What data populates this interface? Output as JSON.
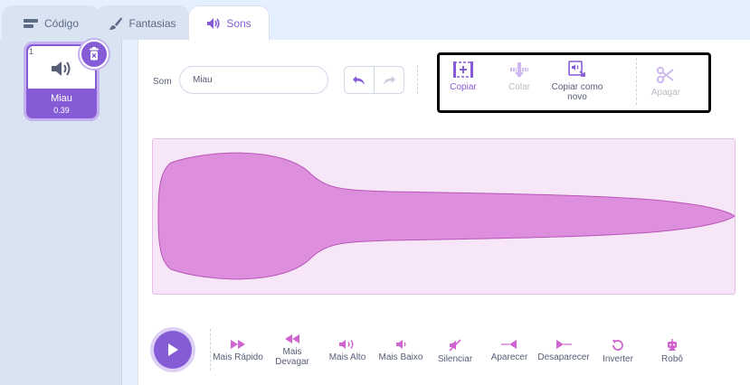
{
  "tabs": [
    {
      "label": "Código",
      "icon": "code-icon"
    },
    {
      "label": "Fantasias",
      "icon": "brush-icon"
    },
    {
      "label": "Sons",
      "icon": "speaker-icon"
    }
  ],
  "active_tab": "Sons",
  "sound_list": {
    "items": [
      {
        "index": "1",
        "name": "Miau",
        "duration": "0.39",
        "icon": "speaker-icon"
      }
    ]
  },
  "editor": {
    "name_label": "Som",
    "name_value": "Miau",
    "edit_tools": {
      "copy": "Copiar",
      "paste": "Colar",
      "copy_new": "Copiar como novo",
      "delete": "Apagar"
    },
    "effects": [
      {
        "label": "Mais Rápido",
        "icon": "faster-icon"
      },
      {
        "label": "Mais Devagar",
        "icon": "slower-icon"
      },
      {
        "label": "Mais Alto",
        "icon": "louder-icon"
      },
      {
        "label": "Mais Baixo",
        "icon": "softer-icon"
      },
      {
        "label": "Silenciar",
        "icon": "mute-icon"
      },
      {
        "label": "Aparecer",
        "icon": "fade-in-icon"
      },
      {
        "label": "Desaparecer",
        "icon": "fade-out-icon"
      },
      {
        "label": "Inverter",
        "icon": "reverse-icon"
      },
      {
        "label": "Robô",
        "icon": "robot-icon"
      }
    ]
  },
  "colors": {
    "accent": "#855cd6",
    "sound_magenta": "#cf63cf",
    "waveform_fill": "#dd8fdd",
    "waveform_bg": "#f7e6f7",
    "highlight_box": "#000000"
  }
}
